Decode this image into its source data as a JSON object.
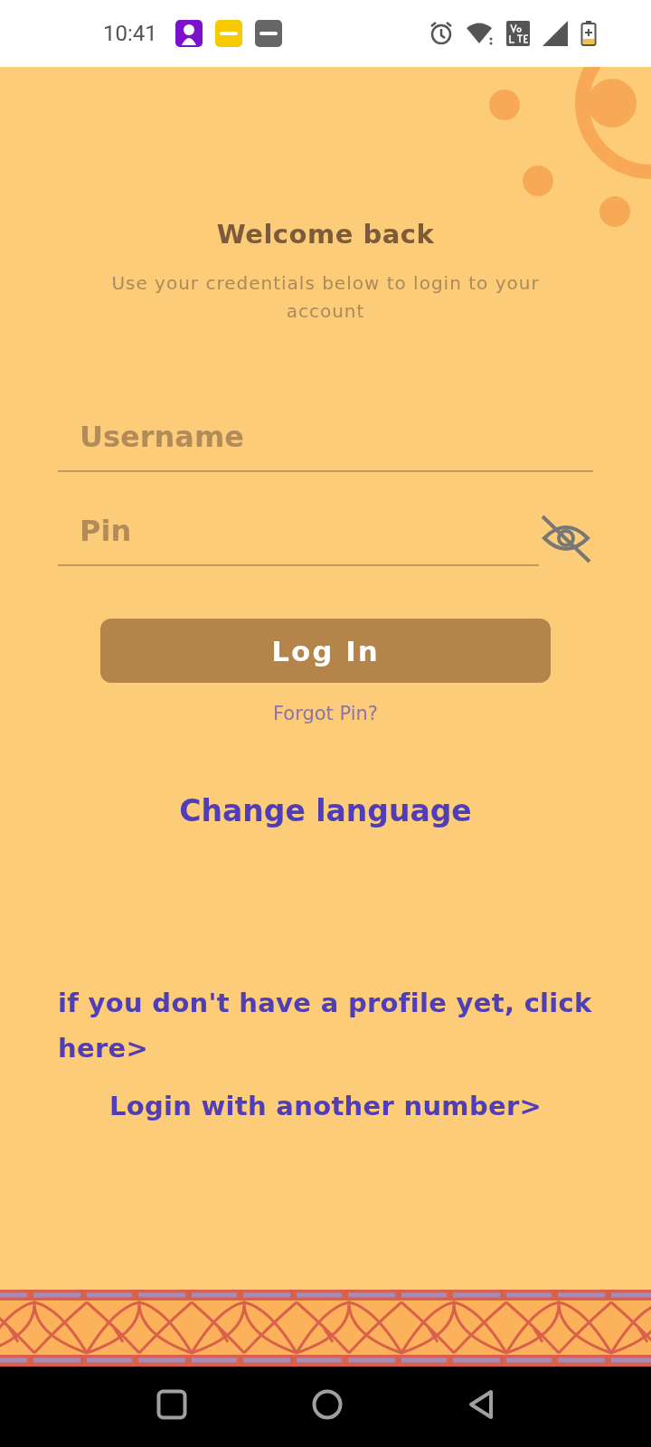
{
  "status_bar": {
    "time": "10:41"
  },
  "title": "Welcome back",
  "subtitle": "Use your credentials below to login to your account",
  "fields": [
    {
      "kind": "text",
      "placeholder": "Username"
    },
    {
      "kind": "password",
      "placeholder": "Pin",
      "revealed": false
    }
  ],
  "login_button": "Log In",
  "forgot_link": "Forgot Pin?",
  "language_link": "Change language",
  "profile_link": "if you don't have a profile yet, click here>",
  "other_number_link": "Login with another number>"
}
